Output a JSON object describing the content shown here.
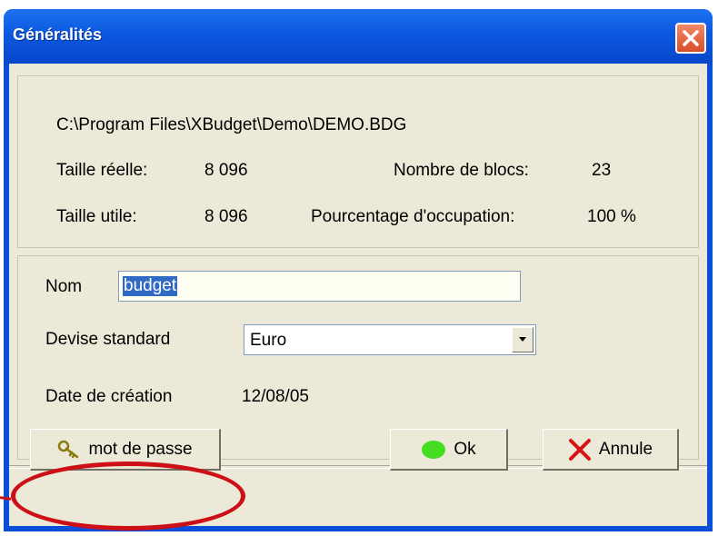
{
  "window": {
    "title": "Généralités"
  },
  "info": {
    "path": "C:\\Program Files\\XBudget\\Demo\\DEMO.BDG",
    "taille_reelle_label": "Taille réelle:",
    "taille_reelle_value": "8 096",
    "nombre_blocs_label": "Nombre de blocs:",
    "nombre_blocs_value": "23",
    "taille_utile_label": "Taille utile:",
    "taille_utile_value": "8 096",
    "pourcentage_label": "Pourcentage d'occupation:",
    "pourcentage_value": "100 %"
  },
  "form": {
    "nom_label": "Nom",
    "nom_value": "budget",
    "devise_label": "Devise standard",
    "devise_value": "Euro",
    "date_label": "Date de création",
    "date_value": "12/08/05"
  },
  "buttons": {
    "password_label": "mot de passe",
    "ok_label": "Ok",
    "cancel_label": "Annule"
  },
  "colors": {
    "title_bar": "#0b58e0",
    "dialog_bg": "#ece9d8",
    "highlight": "#cc1016",
    "ok_indicator": "#44dd22",
    "cancel_x": "#d81414"
  }
}
